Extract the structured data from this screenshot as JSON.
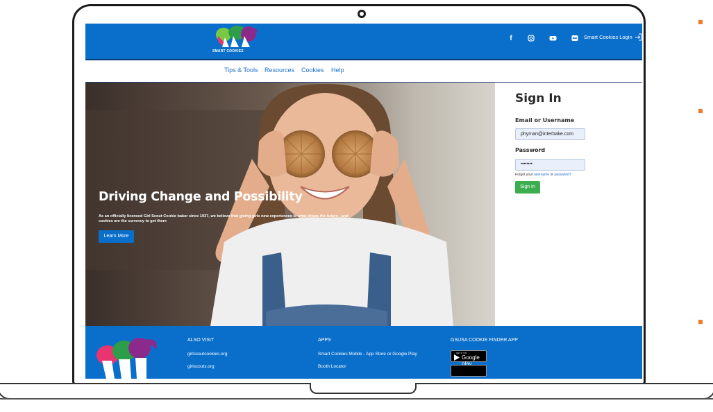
{
  "header": {
    "logo_text": "SMART COOKIES",
    "social_icons": [
      "facebook-icon",
      "instagram-icon",
      "youtube-icon",
      "flickr-icon"
    ],
    "login_label": "Smart Cookies Login"
  },
  "nav": {
    "items": [
      "Tips & Tools",
      "Resources",
      "Cookies",
      "Help"
    ]
  },
  "hero": {
    "title": "Driving Change and Possibility",
    "description": "As an officially licensed Girl Scout Cookie baker since 1937, we believe that giving girls new experiences is what drives the future - and cookies are the currency to get there",
    "button_label": "Learn More"
  },
  "signin": {
    "title": "Sign In",
    "email_label": "Email or Username",
    "email_value": "phyman@interbake.com",
    "password_label": "Password",
    "password_value": "••••••••",
    "forgot_prefix": "Forgot your ",
    "forgot_username": "username",
    "forgot_or": " or ",
    "forgot_password": "password?",
    "button_label": "Sign In"
  },
  "footer": {
    "also_visit_heading": "ALSO VISIT",
    "also_visit_links": [
      "girlscoutcookies.org",
      "girlscouts.org"
    ],
    "apps_heading": "APPS",
    "apps_links": [
      "Smart Cookies Mobile - App Store or Google Play",
      "Booth Locator"
    ],
    "finder_heading": "GSUSA COOKIE FINDER APP",
    "google_play_small": "GET IT ON",
    "google_play_label": "Google play"
  },
  "colors": {
    "brand_blue": "#0a6fcb",
    "signin_green": "#3cae50",
    "accent_orange": "#f07a2a"
  }
}
